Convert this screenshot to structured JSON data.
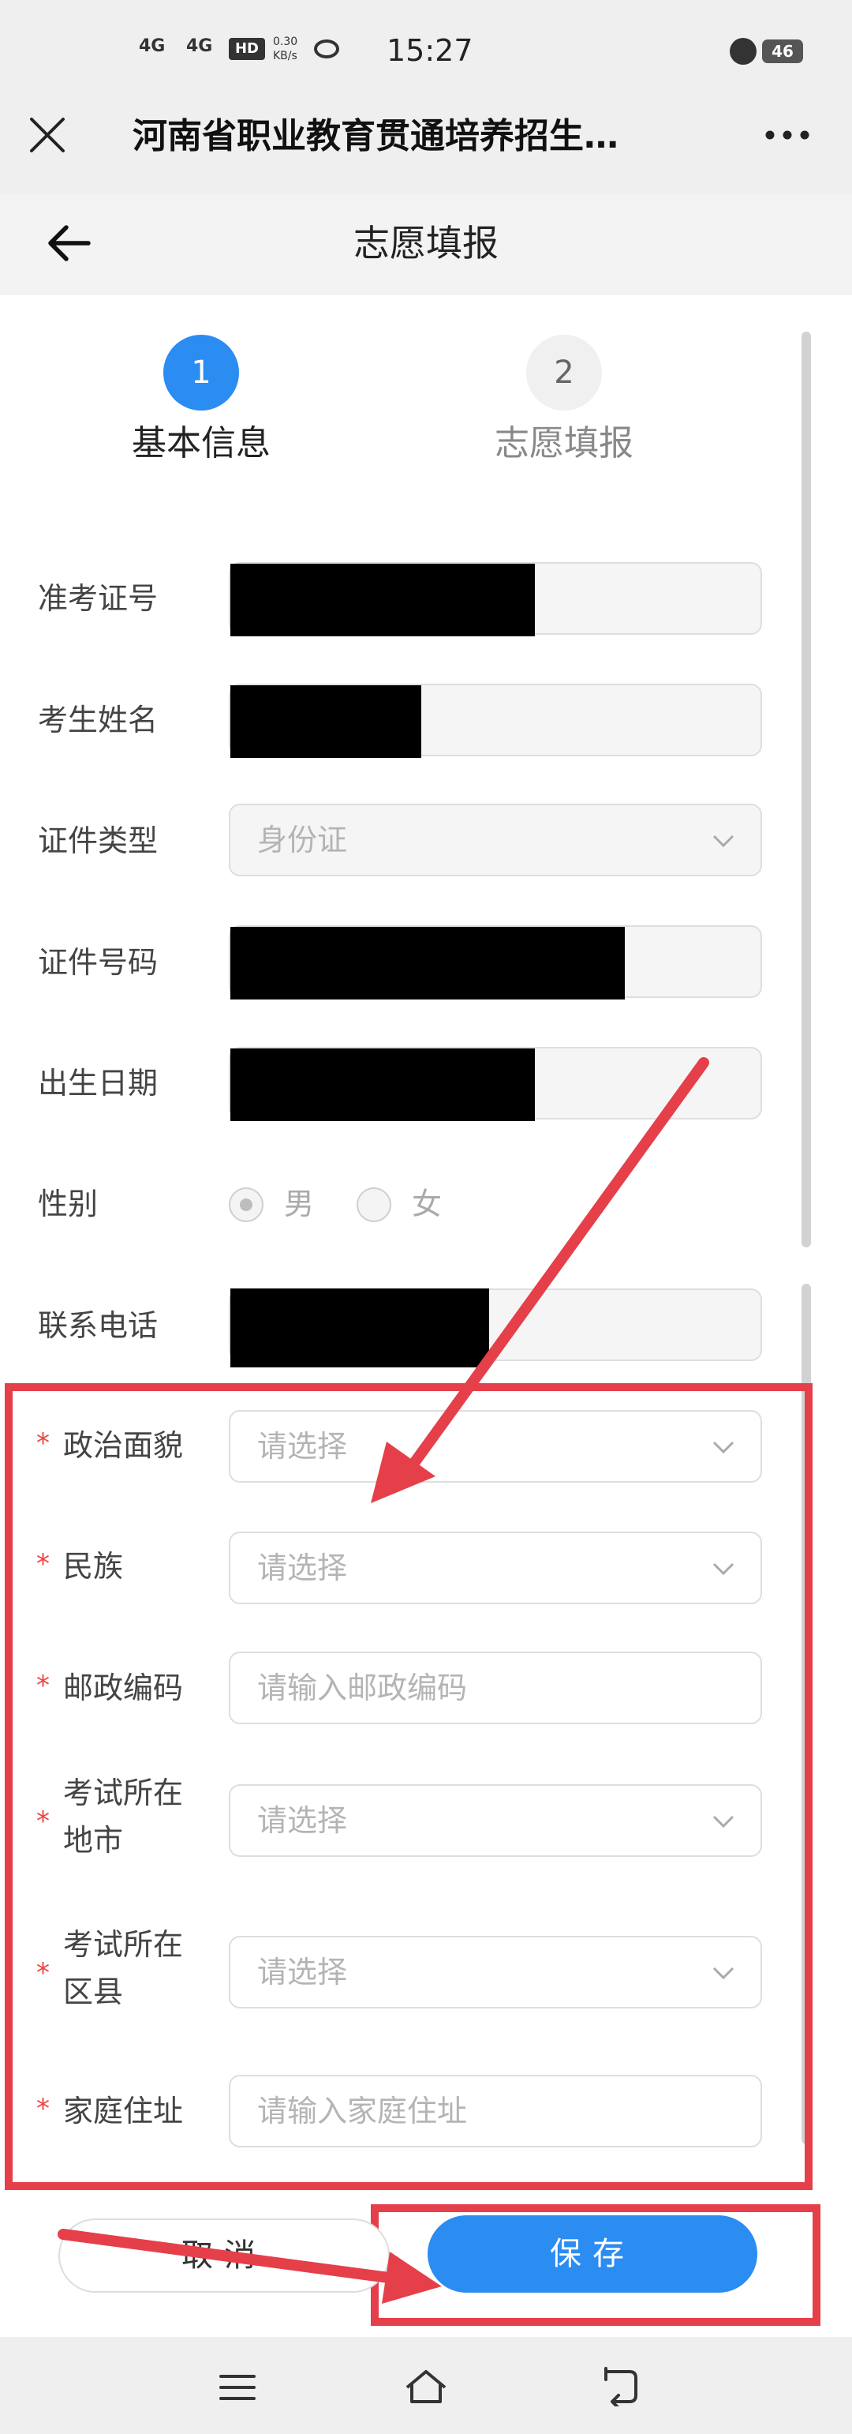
{
  "status_bar": {
    "network1": "4G",
    "network2": "4G",
    "hd": "HD",
    "speed": "0.30\nKB/s",
    "time": "15:27",
    "battery": "46"
  },
  "title_bar": {
    "title": "河南省职业教育贯通培养招生…"
  },
  "page_header": {
    "title": "志愿填报"
  },
  "steps": [
    {
      "number": "1",
      "label": "基本信息",
      "active": true
    },
    {
      "number": "2",
      "label": "志愿填报",
      "active": false
    }
  ],
  "form": {
    "exam_number": {
      "label": "准考证号"
    },
    "student_name": {
      "label": "考生姓名"
    },
    "id_type": {
      "label": "证件类型",
      "value": "身份证"
    },
    "id_number": {
      "label": "证件号码"
    },
    "birth_date": {
      "label": "出生日期"
    },
    "gender": {
      "label": "性别",
      "options": [
        "男",
        "女"
      ],
      "selected": "男"
    },
    "phone": {
      "label": "联系电话"
    },
    "political_status": {
      "label": "政治面貌",
      "required": "*",
      "placeholder": "请选择"
    },
    "ethnicity": {
      "label": "民族",
      "required": "*",
      "placeholder": "请选择"
    },
    "postal_code": {
      "label": "邮政编码",
      "required": "*",
      "placeholder": "请输入邮政编码"
    },
    "exam_city": {
      "label_line1": "考试所在",
      "label_line2": "地市",
      "required": "*",
      "placeholder": "请选择"
    },
    "exam_district": {
      "label_line1": "考试所在",
      "label_line2": "区县",
      "required": "*",
      "placeholder": "请选择"
    },
    "home_address": {
      "label": "家庭住址",
      "required": "*",
      "placeholder": "请输入家庭住址"
    }
  },
  "buttons": {
    "cancel": "取消",
    "save": "保存"
  },
  "colors": {
    "accent": "#2b8cf2",
    "annotation_red": "#e53f4a",
    "required_star": "#e44444"
  }
}
